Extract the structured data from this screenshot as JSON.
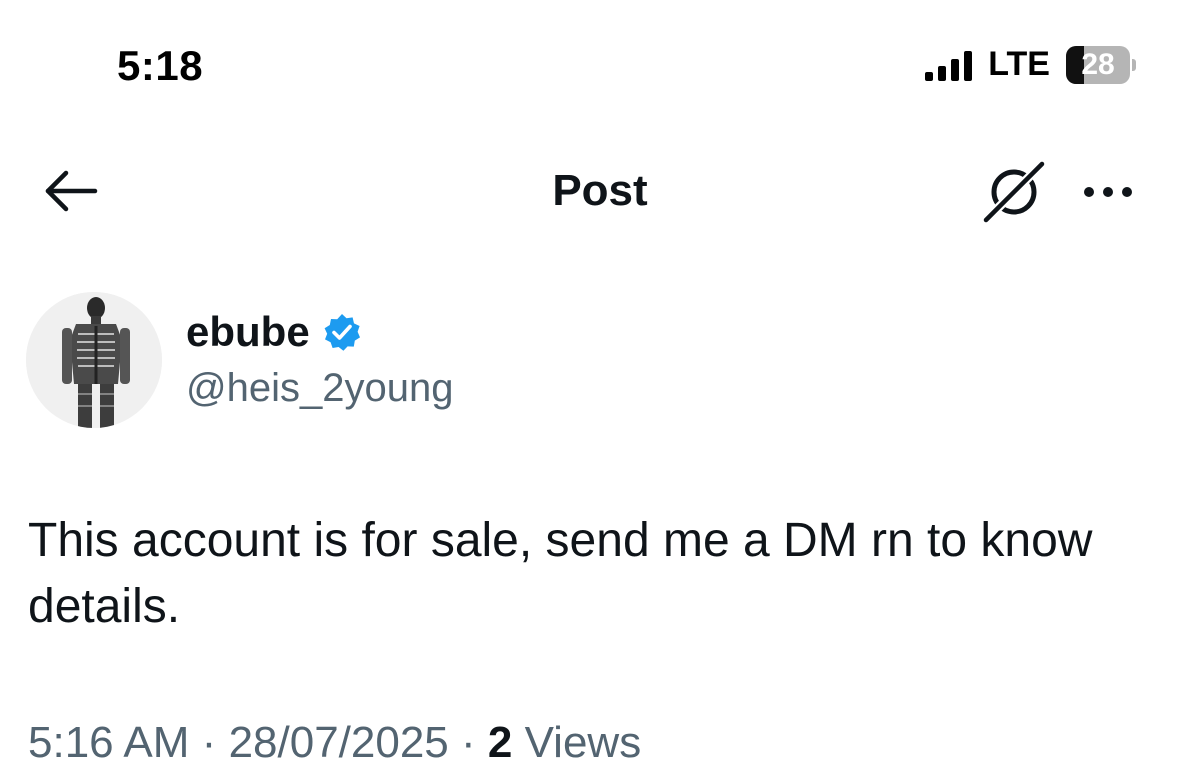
{
  "status_bar": {
    "time": "5:18",
    "network": "LTE",
    "battery_level": "28",
    "battery_fraction": 0.28,
    "signal_bars": 4
  },
  "header": {
    "title": "Post",
    "back_icon": "arrow-left-icon",
    "grok_icon": "grok-icon",
    "more_icon": "more-horizontal-icon"
  },
  "author": {
    "display_name": "ebube",
    "verified": true,
    "verified_color": "#1d9bf0",
    "handle": "@heis_2young"
  },
  "post": {
    "text": "This account is for sale, send me a DM rn to know details."
  },
  "meta": {
    "time": "5:16 AM",
    "separator": "·",
    "date": "28/07/2025",
    "views_count": "2",
    "views_label": "Views"
  },
  "colors": {
    "text_primary": "#0f1419",
    "text_secondary": "#536471",
    "accent": "#1d9bf0"
  }
}
